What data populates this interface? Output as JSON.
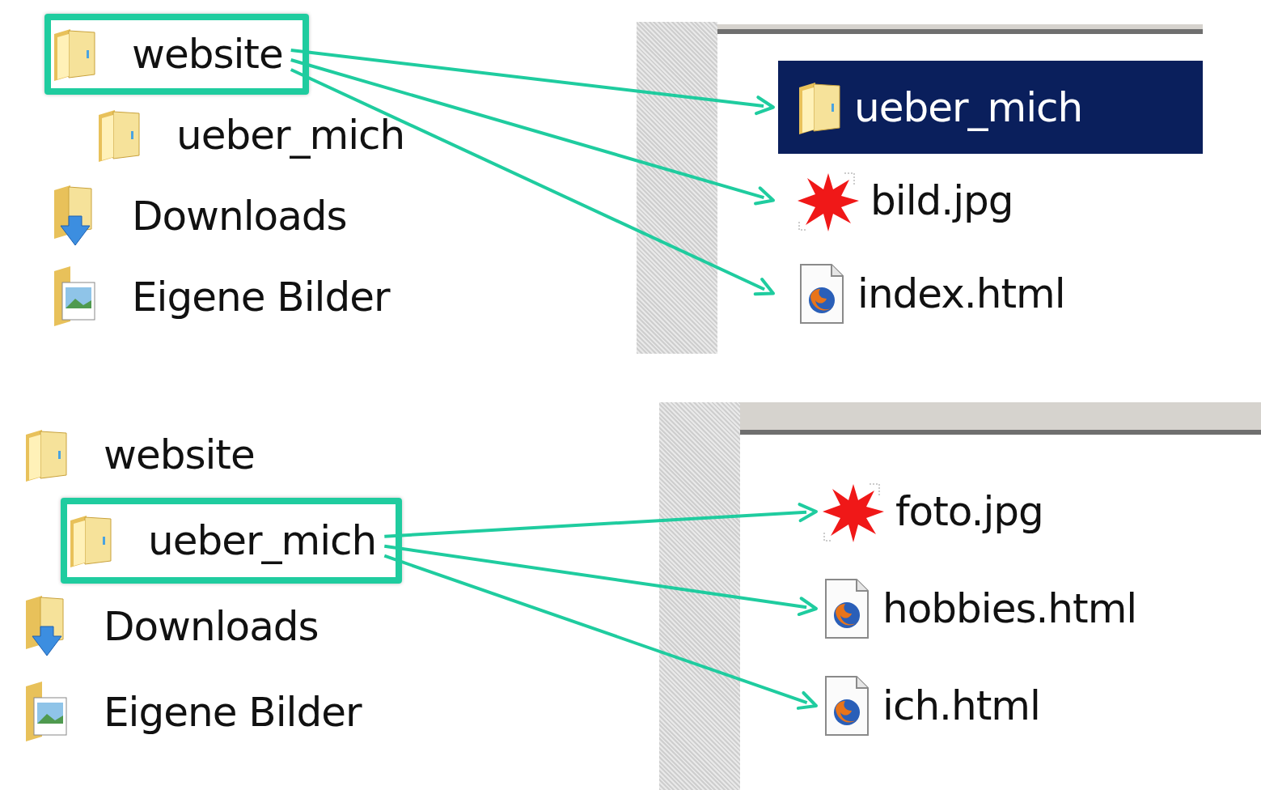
{
  "panels": [
    {
      "tree": [
        {
          "label": "website",
          "kind": "folder",
          "highlighted": true,
          "children": [
            {
              "label": "ueber_mich",
              "kind": "folder",
              "highlighted": false
            }
          ]
        },
        {
          "label": "Downloads",
          "kind": "downloads",
          "highlighted": false
        },
        {
          "label": "Eigene Bilder",
          "kind": "pictures",
          "highlighted": false
        }
      ],
      "files": [
        {
          "name": "ueber_mich",
          "kind": "folder",
          "selected": true
        },
        {
          "name": "bild.jpg",
          "kind": "image",
          "selected": false
        },
        {
          "name": "index.html",
          "kind": "html",
          "selected": false
        }
      ]
    },
    {
      "tree": [
        {
          "label": "website",
          "kind": "folder",
          "highlighted": false,
          "children": [
            {
              "label": "ueber_mich",
              "kind": "folder",
              "highlighted": true
            }
          ]
        },
        {
          "label": "Downloads",
          "kind": "downloads",
          "highlighted": false
        },
        {
          "label": "Eigene Bilder",
          "kind": "pictures",
          "highlighted": false
        }
      ],
      "files": [
        {
          "name": "foto.jpg",
          "kind": "image",
          "selected": false
        },
        {
          "name": "hobbies.html",
          "kind": "html",
          "selected": false
        },
        {
          "name": "ich.html",
          "kind": "html",
          "selected": false
        }
      ]
    }
  ]
}
